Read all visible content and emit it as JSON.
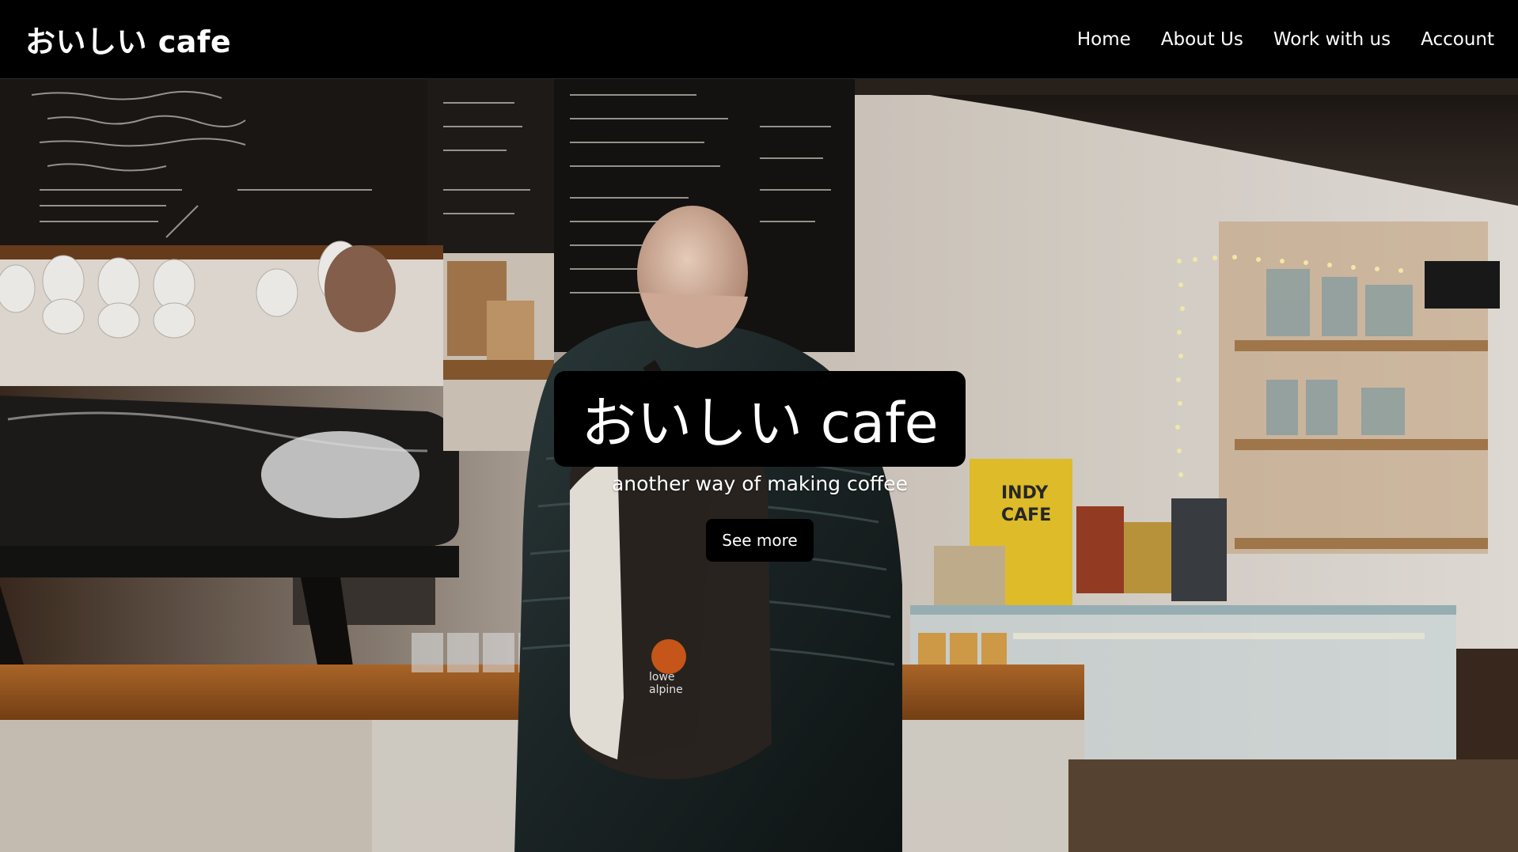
{
  "navbar": {
    "brand": "おいしい cafe",
    "links": [
      {
        "label": "Home"
      },
      {
        "label": "About Us"
      },
      {
        "label": "Work with us"
      },
      {
        "label": "Account"
      }
    ]
  },
  "hero": {
    "title": "おいしい cafe",
    "subtitle": "another way of making coffee",
    "button_label": "See more",
    "background_image": "cafe-counter-photo"
  },
  "colors": {
    "navbar_bg": "#000000",
    "text": "#ffffff",
    "button_bg": "#000000"
  }
}
